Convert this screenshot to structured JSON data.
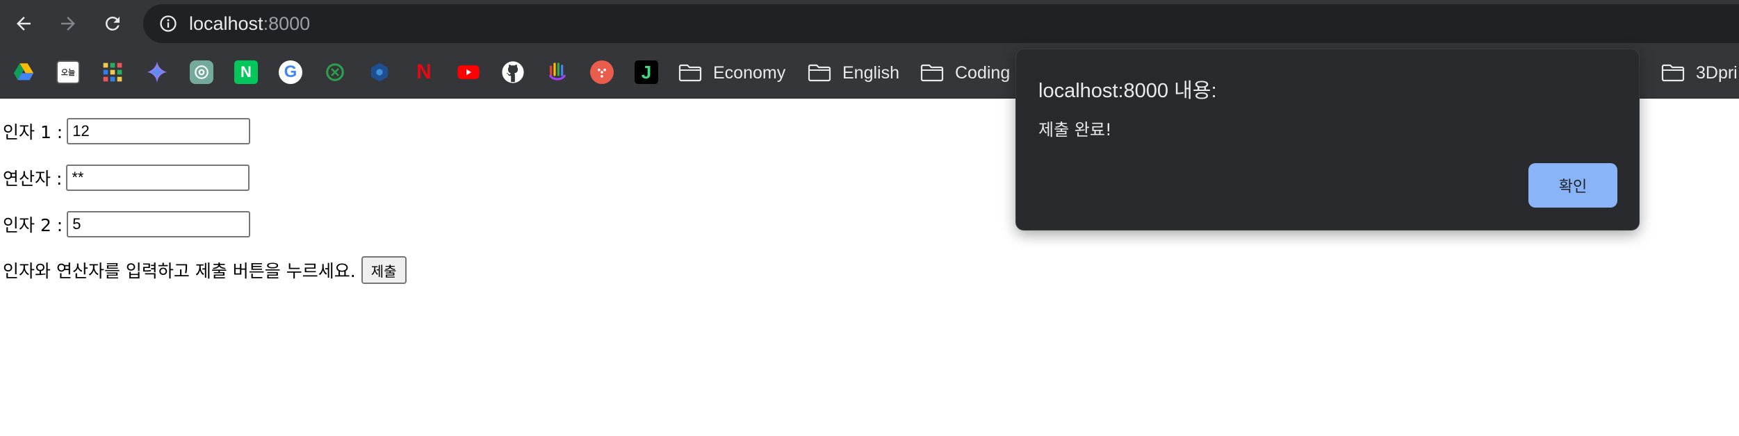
{
  "browser": {
    "url_host": "localhost",
    "url_port": ":8000",
    "bookmarks": {
      "icons": [
        {
          "name": "google-drive-icon"
        },
        {
          "name": "bookmark-app-icon",
          "text": "오늘"
        },
        {
          "name": "apps-grid-icon"
        },
        {
          "name": "sparkle-icon"
        },
        {
          "name": "chatgpt-icon"
        },
        {
          "name": "naver-icon",
          "text": "N"
        },
        {
          "name": "google-icon",
          "text": "G"
        },
        {
          "name": "green-app-icon"
        },
        {
          "name": "blue-app-icon"
        },
        {
          "name": "netflix-icon",
          "text": "N"
        },
        {
          "name": "youtube-icon"
        },
        {
          "name": "github-icon"
        },
        {
          "name": "hand-app-icon"
        },
        {
          "name": "red-app-icon"
        },
        {
          "name": "j-app-icon",
          "text": "J"
        }
      ],
      "folders": [
        "Economy",
        "English",
        "Coding",
        "3Dpri"
      ]
    },
    "colors": {
      "chrome_bg": "#35363a",
      "omnibox_bg": "#202124",
      "dialog_bg": "#292a2d",
      "dialog_button": "#8ab4f8"
    }
  },
  "form": {
    "arg1_label": "인자 1 :",
    "arg1_value": "12",
    "operator_label": "연산자 :",
    "operator_value": "**",
    "arg2_label": "인자 2 :",
    "arg2_value": "5",
    "instruction": "인자와 연산자를 입력하고 제출 버튼을 누르세요.",
    "submit_label": "제출"
  },
  "alert": {
    "title": "localhost:8000 내용:",
    "message": "제출 완료!",
    "ok_label": "확인"
  }
}
